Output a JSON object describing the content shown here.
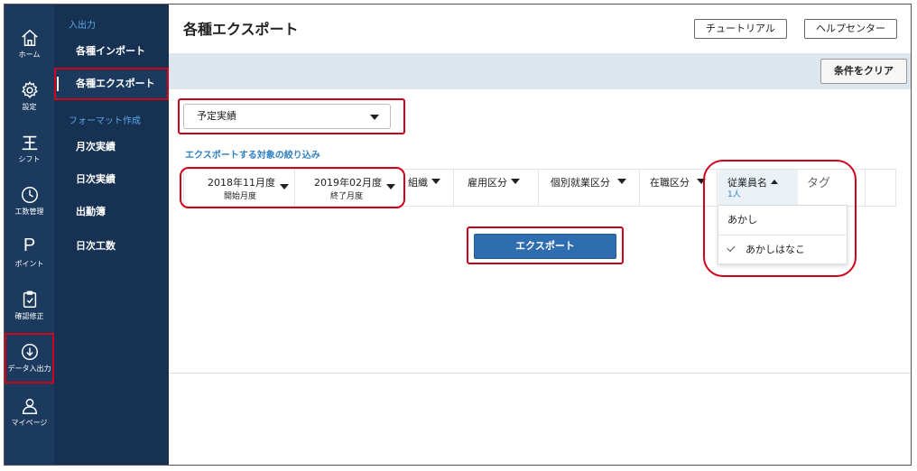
{
  "rail": [
    {
      "icon": "home-icon",
      "label": "ホーム"
    },
    {
      "icon": "gear-icon",
      "label": "設定"
    },
    {
      "icon": "shift-icon",
      "label": "シフト"
    },
    {
      "icon": "clock-icon",
      "label": "工数管理"
    },
    {
      "icon": "point-icon",
      "glyph": "P",
      "label": "ポイント"
    },
    {
      "icon": "clipboard-check-icon",
      "label": "確認修正"
    },
    {
      "icon": "download-circle-icon",
      "label": "データ入出力"
    },
    {
      "icon": "user-icon",
      "label": "マイページ"
    }
  ],
  "subnav": {
    "section_io": "入出力",
    "import_label": "各種インポート",
    "export_label": "各種エクスポート",
    "section_format": "フォーマット作成",
    "monthly_label": "月次実績",
    "daily_label": "日次実績",
    "attendance_label": "出勤簿",
    "daily_hours_label": "日次工数"
  },
  "header": {
    "title": "各種エクスポート",
    "tutorial_label": "チュートリアル",
    "help_label": "ヘルプセンター",
    "clear_label": "条件をクリア"
  },
  "export_type": {
    "selected": "予定実績"
  },
  "filter": {
    "heading": "エクスポートする対象の絞り込み",
    "start_value": "2018年11月度",
    "start_caption": "開始月度",
    "end_value": "2019年02月度",
    "end_caption": "終了月度",
    "org_label": "組織",
    "employment_label": "雇用区分",
    "rules_label": "個別就業区分",
    "status_label": "在職区分",
    "employee_label": "従業員名",
    "employee_count": "1人",
    "tag_label": "タグ"
  },
  "employee_options": [
    {
      "name": "あかし",
      "selected": false
    },
    {
      "name": "あかしはなこ",
      "selected": true
    }
  ],
  "export_button": "エクスポート",
  "colors": {
    "rail": "#1b3a5e",
    "subnav": "#163152",
    "accent": "#2e6db0",
    "highlight": "#d0021b"
  }
}
